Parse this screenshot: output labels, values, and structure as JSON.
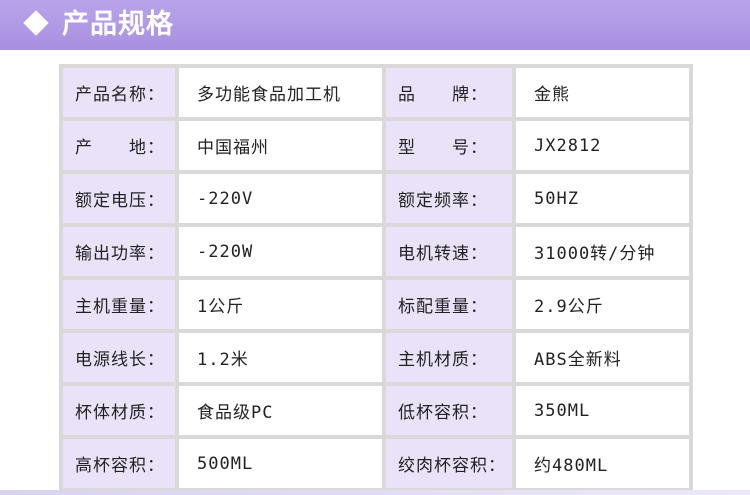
{
  "header": {
    "title": "产品规格"
  },
  "rows": [
    {
      "label1": "产品名称：",
      "value1": "多功能食品加工机",
      "label2": "品　　牌：",
      "value2": "金熊"
    },
    {
      "label1": "产　　地：",
      "value1": "中国福州",
      "label2": "型　　号：",
      "value2": "JX2812"
    },
    {
      "label1": "额定电压：",
      "value1": "-220V",
      "label2": "额定频率：",
      "value2": "50HZ"
    },
    {
      "label1": "输出功率：",
      "value1": "-220W",
      "label2": "电机转速：",
      "value2": "31000转/分钟"
    },
    {
      "label1": "主机重量：",
      "value1": "1公斤",
      "label2": "标配重量：",
      "value2": "2.9公斤"
    },
    {
      "label1": "电源线长：",
      "value1": "1.2米",
      "label2": "主机材质：",
      "value2": "ABS全新料"
    },
    {
      "label1": "杯体材质：",
      "value1": "食品级PC",
      "label2": "低杯容积：",
      "value2": "350ML"
    },
    {
      "label1": "高杯容积：",
      "value1": "500ML",
      "label2": "绞肉杯容积：",
      "value2": "约480ML"
    }
  ]
}
